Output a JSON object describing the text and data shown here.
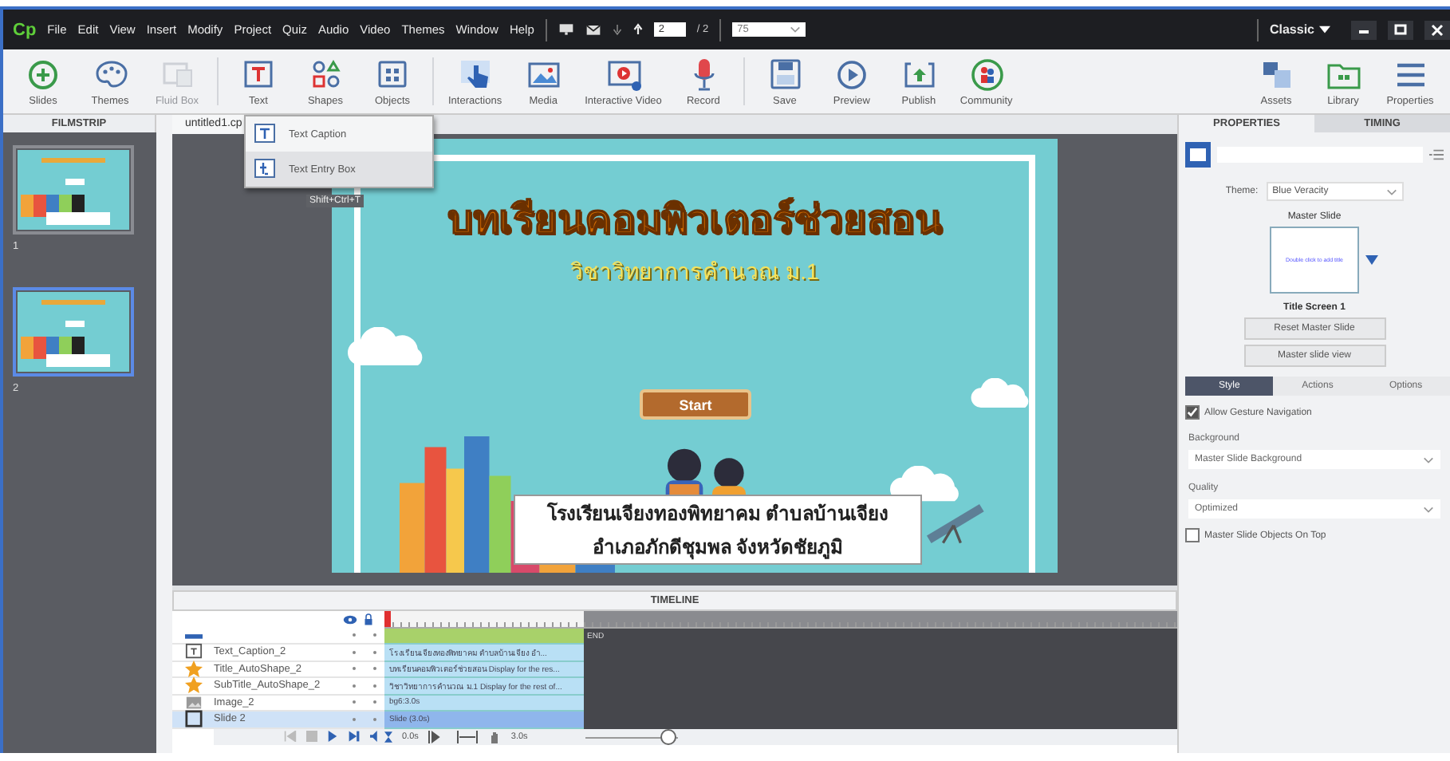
{
  "menubar": {
    "logo": "Cp",
    "menus": [
      "File",
      "Edit",
      "View",
      "Insert",
      "Modify",
      "Project",
      "Quiz",
      "Audio",
      "Video",
      "Themes",
      "Window",
      "Help"
    ],
    "page_current": "2",
    "page_total": "/ 2",
    "zoom": "75",
    "workspace": "Classic"
  },
  "toolbar": {
    "groups": [
      [
        {
          "label": "Slides",
          "disabled": false
        },
        {
          "label": "Themes",
          "disabled": false
        },
        {
          "label": "Fluid Box",
          "disabled": true
        }
      ],
      [
        {
          "label": "Text",
          "disabled": false
        },
        {
          "label": "Shapes",
          "disabled": false
        },
        {
          "label": "Objects",
          "disabled": false
        }
      ],
      [
        {
          "label": "Interactions",
          "disabled": false
        },
        {
          "label": "Media",
          "disabled": false
        },
        {
          "label": "Interactive Video",
          "disabled": false
        },
        {
          "label": "Record",
          "disabled": false
        }
      ],
      [
        {
          "label": "Save",
          "disabled": false
        },
        {
          "label": "Preview",
          "disabled": false
        },
        {
          "label": "Publish",
          "disabled": false
        },
        {
          "label": "Community",
          "disabled": false
        }
      ]
    ],
    "right": [
      "Assets",
      "Library",
      "Properties"
    ]
  },
  "filmstrip": {
    "title": "FILMSTRIP",
    "slides": [
      {
        "number": "1",
        "selected": false
      },
      {
        "number": "2",
        "selected": true
      }
    ]
  },
  "document_tab": "untitled1.cp",
  "text_menu": {
    "items": [
      {
        "label": "Text Caption",
        "selected": false
      },
      {
        "label": "Text Entry Box",
        "selected": true
      }
    ],
    "tooltip": "Shift+Ctrl+T"
  },
  "slide": {
    "title": "บทเรียนคอมพิวเตอร์ช่วยสอน",
    "subtitle": "วิชาวิทยาการคำนวณ ม.1",
    "button": "Start",
    "caption": [
      "โรงเรียนเจียงทองพิทยาคม ตำบลบ้านเจียง",
      "อำเภอภักดีชุมพล จังหวัดชัยภูมิ"
    ]
  },
  "timeline": {
    "title": "TIMELINE",
    "end_label": "END",
    "layers": [
      {
        "kind": "button",
        "selected": false
      },
      {
        "kind": "caption",
        "name": "Text_Caption_2",
        "bar": "โรงเรียนเจียงทองพิทยาคม ตำบลบ้านเจียง อำ...",
        "selected": false
      },
      {
        "kind": "shape",
        "name": "Title_AutoShape_2",
        "bar": "บทเรียนคอมพิวเตอร์ช่วยสอน Display for the res...",
        "selected": false
      },
      {
        "kind": "shape",
        "name": "SubTitle_AutoShape_2",
        "bar": "วิชาวิทยาการคำนวณ ม.1 Display for the rest of...",
        "selected": false
      },
      {
        "kind": "image",
        "name": "Image_2",
        "bar": "bg6:3.0s",
        "selected": false
      },
      {
        "kind": "slide",
        "name": "Slide 2",
        "bar": "Slide (3.0s)",
        "selected": true
      }
    ],
    "start_time": "0.0s",
    "duration": "3.0s",
    "zoom": {
      "level": 0.9
    }
  },
  "properties": {
    "tabs": [
      {
        "label": "PROPERTIES",
        "selected": true
      },
      {
        "label": "TIMING",
        "selected": false
      }
    ],
    "theme_label": "Theme:",
    "theme": "Blue Veracity",
    "master_slide_label": "Master Slide",
    "master_thumb_text": "Double click to add title",
    "master_name": "Title Screen 1",
    "buttons": [
      "Reset Master Slide",
      "Master slide view"
    ],
    "subtabs": [
      {
        "label": "Style",
        "selected": true
      },
      {
        "label": "Actions",
        "selected": false
      },
      {
        "label": "Options",
        "selected": false
      }
    ],
    "gesture": {
      "label": "Allow Gesture Navigation",
      "checked": true
    },
    "background_label": "Background",
    "background": "Master Slide Background",
    "quality_label": "Quality",
    "quality": "Optimized",
    "on_top": {
      "label": "Master Slide Objects On Top",
      "checked": false
    }
  }
}
